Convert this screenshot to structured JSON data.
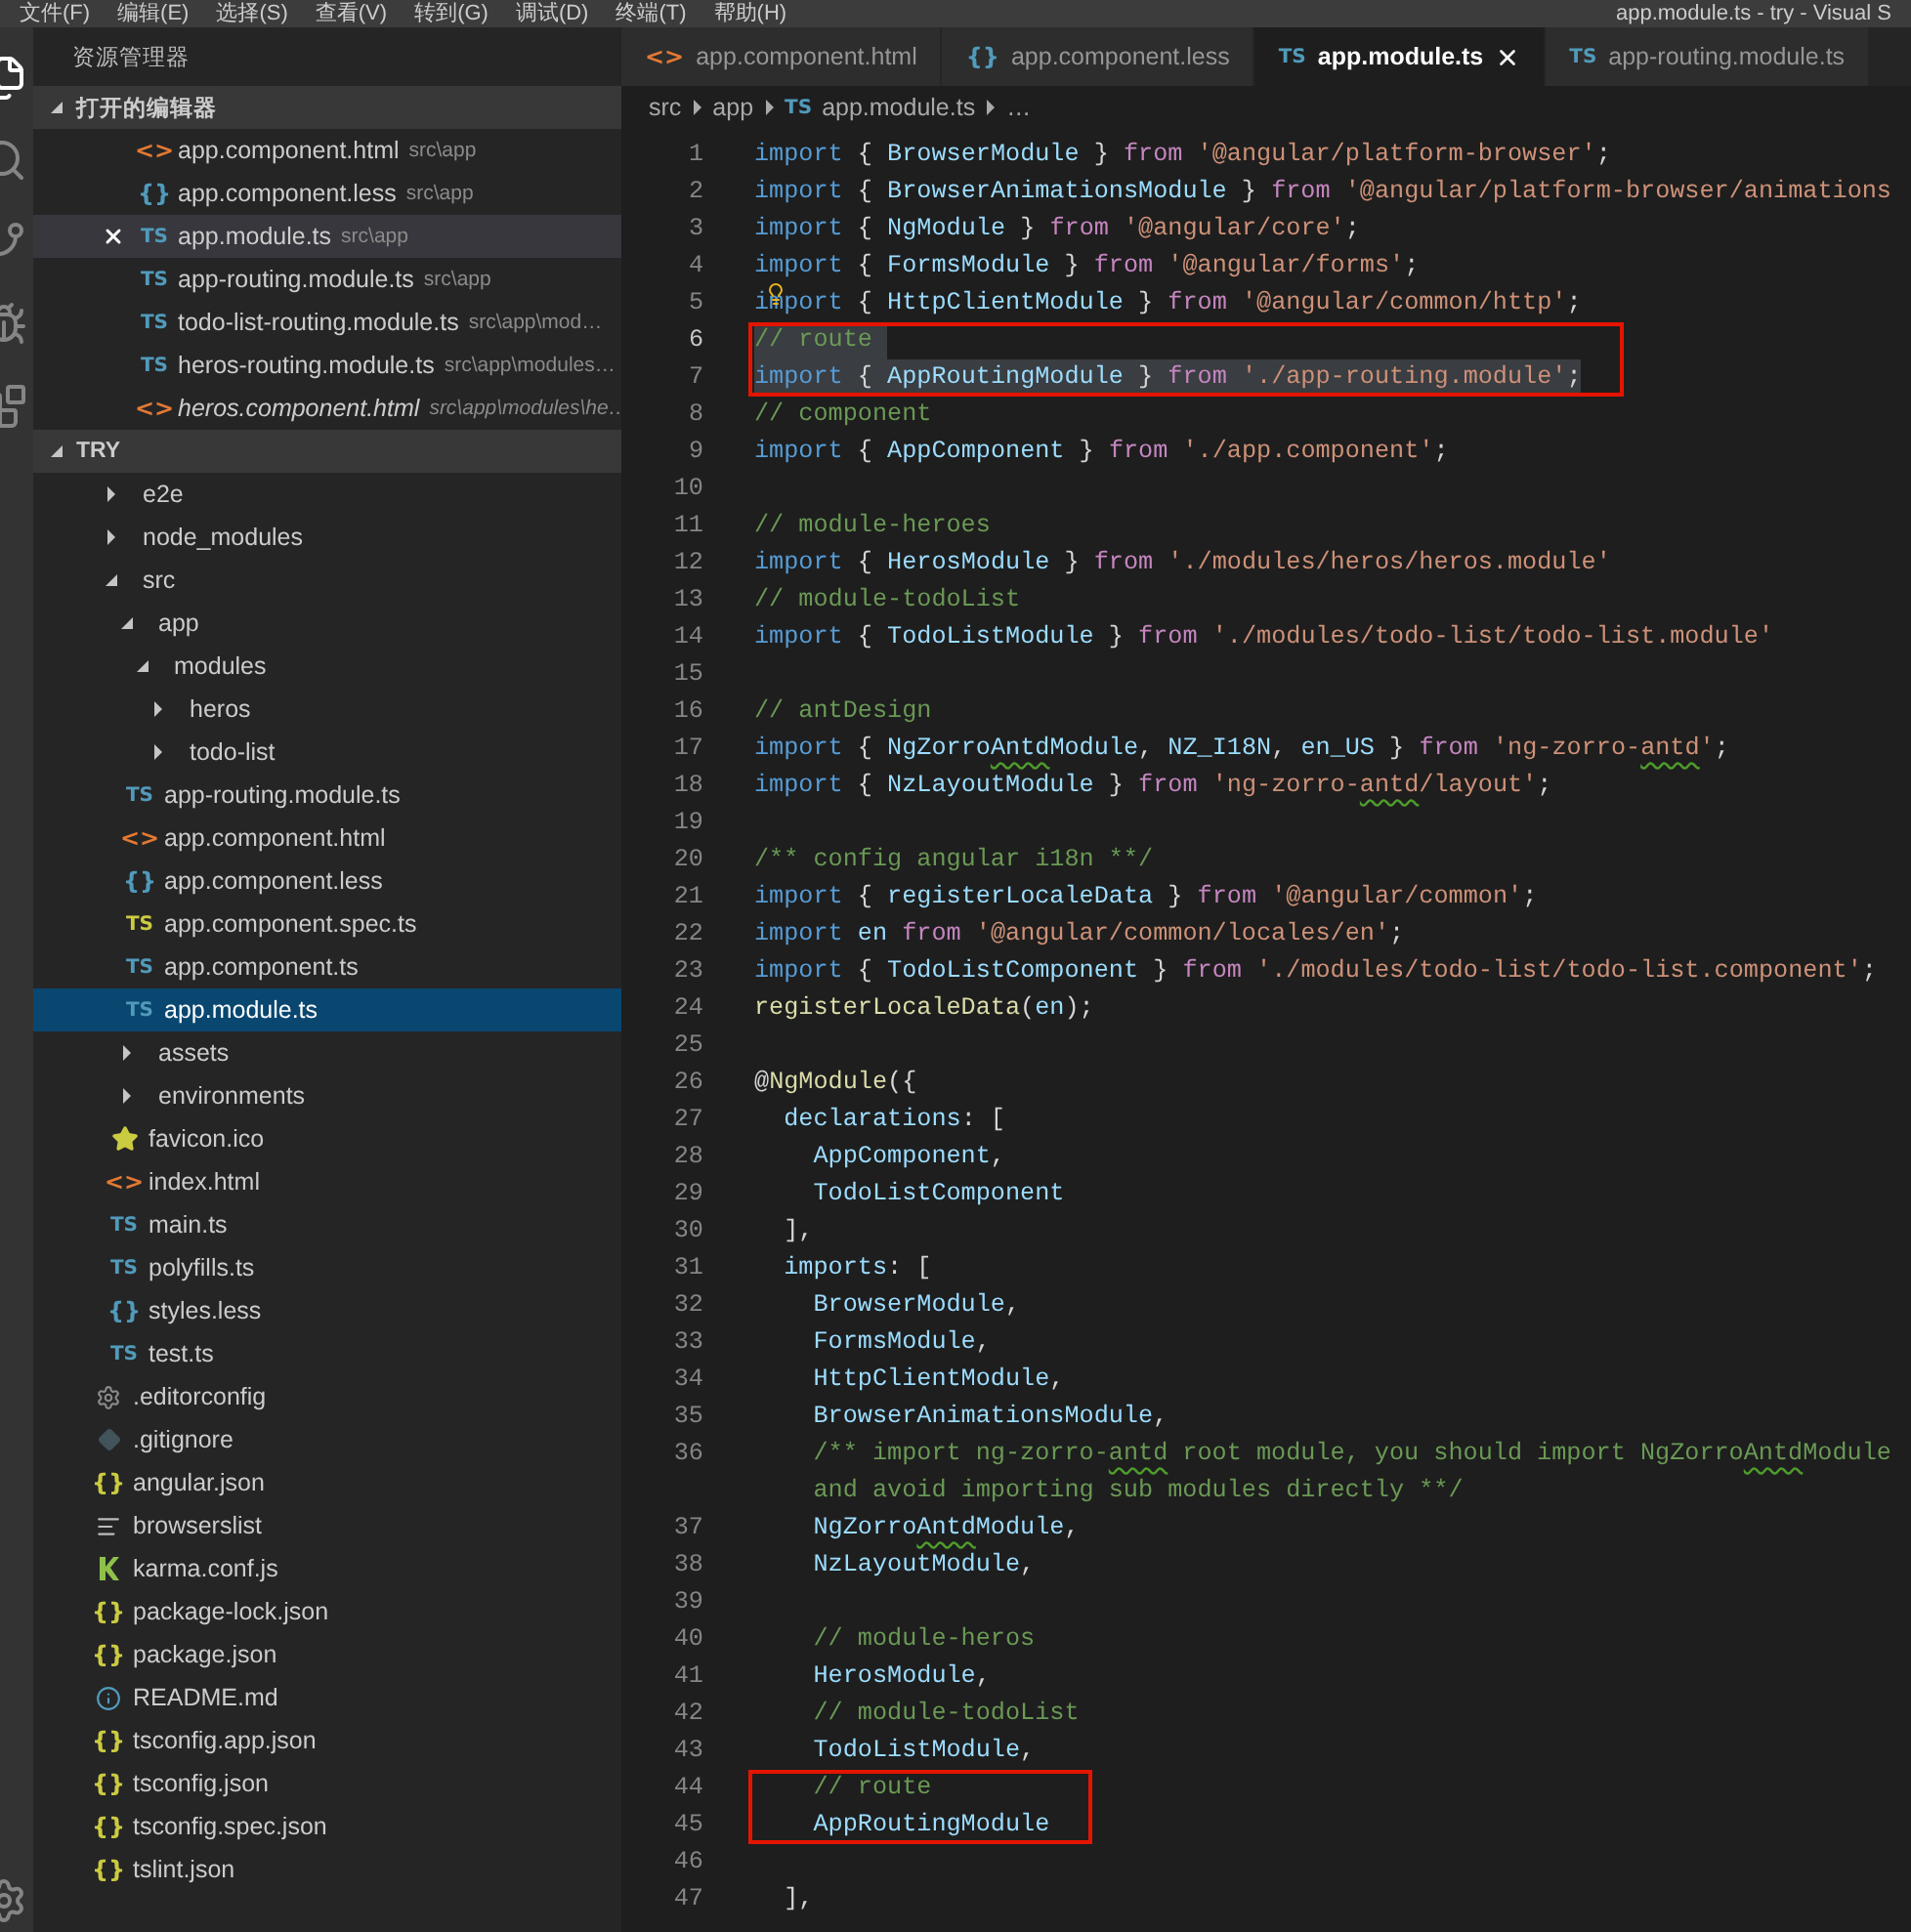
{
  "menu": [
    "文件(F)",
    "编辑(E)",
    "选择(S)",
    "查看(V)",
    "转到(G)",
    "调试(D)",
    "终端(T)",
    "帮助(H)"
  ],
  "window_title": "app.module.ts - try - Visual S",
  "activity_bar": [
    {
      "kind": "files",
      "selected": true
    },
    {
      "kind": "search",
      "selected": false
    },
    {
      "kind": "git",
      "selected": false
    },
    {
      "kind": "debug",
      "selected": false
    },
    {
      "kind": "extensions",
      "selected": false
    },
    {
      "kind": "settings",
      "selected": false
    }
  ],
  "explorer": {
    "title": "资源管理器",
    "open_editors": {
      "title": "打开的编辑器",
      "expanded": true,
      "items": [
        {
          "name": "app.component.html",
          "path": "src\\app",
          "kind": "html",
          "icon": "<>",
          "selected": false,
          "italic": false
        },
        {
          "name": "app.component.less",
          "path": "src\\app",
          "kind": "less",
          "icon": "{}",
          "selected": false,
          "italic": false
        },
        {
          "name": "app.module.ts",
          "path": "src\\app",
          "kind": "ts",
          "icon": "TS",
          "selected": true,
          "italic": false
        },
        {
          "name": "app-routing.module.ts",
          "path": "src\\app",
          "kind": "ts",
          "icon": "TS",
          "selected": false,
          "italic": false
        },
        {
          "name": "todo-list-routing.module.ts",
          "path": "src\\app\\mod…",
          "kind": "ts",
          "icon": "TS",
          "selected": false,
          "italic": false
        },
        {
          "name": "heros-routing.module.ts",
          "path": "src\\app\\modules…",
          "kind": "ts",
          "icon": "TS",
          "selected": false,
          "italic": false
        },
        {
          "name": "heros.component.html",
          "path": "src\\app\\modules\\he…",
          "kind": "html",
          "icon": "<>",
          "selected": false,
          "italic": true
        }
      ]
    },
    "workspace": {
      "title": "TRY",
      "expanded": true,
      "tree": [
        {
          "name": "e2e",
          "kind": "folder",
          "expanded": false,
          "selected": false
        },
        {
          "name": "node_modules",
          "kind": "folder",
          "expanded": false,
          "selected": false
        },
        {
          "name": "src",
          "kind": "folder",
          "expanded": true,
          "selected": false,
          "children": [
            {
              "name": "app",
              "kind": "folder",
              "expanded": true,
              "selected": false,
              "children": [
                {
                  "name": "modules",
                  "kind": "folder",
                  "expanded": true,
                  "selected": false,
                  "children": [
                    {
                      "name": "heros",
                      "kind": "folder",
                      "expanded": false,
                      "selected": false
                    },
                    {
                      "name": "todo-list",
                      "kind": "folder",
                      "expanded": false,
                      "selected": false
                    }
                  ]
                },
                {
                  "name": "app-routing.module.ts",
                  "kind": "ts",
                  "icon": "TS",
                  "selected": false
                },
                {
                  "name": "app.component.html",
                  "kind": "html",
                  "icon": "<>",
                  "selected": false
                },
                {
                  "name": "app.component.less",
                  "kind": "less",
                  "icon": "{}",
                  "selected": false
                },
                {
                  "name": "app.component.spec.ts",
                  "kind": "spec",
                  "icon": "TS",
                  "selected": false
                },
                {
                  "name": "app.component.ts",
                  "kind": "ts",
                  "icon": "TS",
                  "selected": false
                },
                {
                  "name": "app.module.ts",
                  "kind": "ts",
                  "icon": "TS",
                  "selected": true
                }
              ]
            },
            {
              "name": "assets",
              "kind": "folder",
              "expanded": false,
              "selected": false
            },
            {
              "name": "environments",
              "kind": "folder",
              "expanded": false,
              "selected": false
            },
            {
              "name": "favicon.ico",
              "kind": "star",
              "selected": false
            },
            {
              "name": "index.html",
              "kind": "html",
              "icon": "<>",
              "selected": false
            },
            {
              "name": "main.ts",
              "kind": "ts",
              "icon": "TS",
              "selected": false
            },
            {
              "name": "polyfills.ts",
              "kind": "ts",
              "icon": "TS",
              "selected": false
            },
            {
              "name": "styles.less",
              "kind": "less",
              "icon": "{}",
              "selected": false
            },
            {
              "name": "test.ts",
              "kind": "ts",
              "icon": "TS",
              "selected": false
            }
          ]
        },
        {
          "name": ".editorconfig",
          "kind": "gear",
          "selected": false
        },
        {
          "name": ".gitignore",
          "kind": "git",
          "selected": false
        },
        {
          "name": "angular.json",
          "kind": "json",
          "icon": "{}",
          "selected": false
        },
        {
          "name": "browserslist",
          "kind": "list",
          "selected": false
        },
        {
          "name": "karma.conf.js",
          "kind": "karma",
          "selected": false
        },
        {
          "name": "package-lock.json",
          "kind": "json",
          "icon": "{}",
          "selected": false
        },
        {
          "name": "package.json",
          "kind": "json",
          "icon": "{}",
          "selected": false
        },
        {
          "name": "README.md",
          "kind": "info",
          "selected": false
        },
        {
          "name": "tsconfig.app.json",
          "kind": "json",
          "icon": "{}",
          "selected": false
        },
        {
          "name": "tsconfig.json",
          "kind": "json",
          "icon": "{}",
          "selected": false
        },
        {
          "name": "tsconfig.spec.json",
          "kind": "json",
          "icon": "{}",
          "selected": false
        },
        {
          "name": "tslint.json",
          "kind": "json",
          "icon": "{}",
          "selected": false
        }
      ]
    }
  },
  "tabs": [
    {
      "label": "app.component.html",
      "kind": "html",
      "icon": "<>",
      "selected": false
    },
    {
      "label": "app.component.less",
      "kind": "less",
      "icon": "{}",
      "selected": false
    },
    {
      "label": "app.module.ts",
      "kind": "ts",
      "icon": "TS",
      "selected": true
    },
    {
      "label": "app-routing.module.ts",
      "kind": "ts",
      "icon": "TS",
      "selected": false
    }
  ],
  "breadcrumbs": [
    {
      "label": "src",
      "kind": "folder"
    },
    {
      "label": "app",
      "kind": "folder"
    },
    {
      "label": "app.module.ts",
      "kind": "ts",
      "icon": "TS"
    },
    {
      "label": "…",
      "kind": "more"
    }
  ],
  "code": [
    {
      "number": "1",
      "selected": false,
      "boxed": false,
      "tokens": [
        {
          "kind": "kw",
          "text": "import"
        },
        {
          "kind": "p",
          "text": " { "
        },
        {
          "kind": "id",
          "text": "BrowserModule"
        },
        {
          "kind": "p",
          "text": " } "
        },
        {
          "kind": "ctl",
          "text": "from "
        },
        {
          "kind": "str",
          "text": "'@angular/platform-browser'"
        },
        {
          "kind": "p",
          "text": ";"
        }
      ]
    },
    {
      "number": "2",
      "selected": false,
      "boxed": false,
      "tokens": [
        {
          "kind": "kw",
          "text": "import"
        },
        {
          "kind": "p",
          "text": " { "
        },
        {
          "kind": "id",
          "text": "BrowserAnimationsModule"
        },
        {
          "kind": "p",
          "text": " } "
        },
        {
          "kind": "ctl",
          "text": "from "
        },
        {
          "kind": "str",
          "text": "'@angular/platform-browser/animations"
        }
      ]
    },
    {
      "number": "3",
      "selected": false,
      "boxed": false,
      "tokens": [
        {
          "kind": "kw",
          "text": "import"
        },
        {
          "kind": "p",
          "text": " { "
        },
        {
          "kind": "id",
          "text": "NgModule"
        },
        {
          "kind": "p",
          "text": " } "
        },
        {
          "kind": "ctl",
          "text": "from "
        },
        {
          "kind": "str",
          "text": "'@angular/core'"
        },
        {
          "kind": "p",
          "text": ";"
        }
      ]
    },
    {
      "number": "4",
      "selected": false,
      "boxed": false,
      "tokens": [
        {
          "kind": "kw",
          "text": "import"
        },
        {
          "kind": "p",
          "text": " { "
        },
        {
          "kind": "id",
          "text": "FormsModule"
        },
        {
          "kind": "p",
          "text": " } "
        },
        {
          "kind": "ctl",
          "text": "from "
        },
        {
          "kind": "str",
          "text": "'@angular/forms'"
        },
        {
          "kind": "p",
          "text": ";"
        }
      ]
    },
    {
      "number": "5",
      "selected": false,
      "boxed": false,
      "bulb": true,
      "tokens": [
        {
          "kind": "kw",
          "text": "import"
        },
        {
          "kind": "p",
          "text": " { "
        },
        {
          "kind": "id",
          "text": "HttpClientModule"
        },
        {
          "kind": "p",
          "text": " } "
        },
        {
          "kind": "ctl",
          "text": "from "
        },
        {
          "kind": "str",
          "text": "'@angular/common/http'"
        },
        {
          "kind": "p",
          "text": ";"
        }
      ]
    },
    {
      "number": "6",
      "current": true,
      "selected": true,
      "boxed": true,
      "tokens": [
        {
          "kind": "cm",
          "text": "// route "
        }
      ]
    },
    {
      "number": "7",
      "selected": true,
      "boxed": true,
      "tokens": [
        {
          "kind": "kw",
          "text": "import"
        },
        {
          "kind": "p",
          "text": " { "
        },
        {
          "kind": "id",
          "text": "AppRoutingModule"
        },
        {
          "kind": "p",
          "text": " } "
        },
        {
          "kind": "ctl",
          "text": "from "
        },
        {
          "kind": "str",
          "text": "'./app-routing.module'"
        },
        {
          "kind": "p",
          "text": ";"
        }
      ]
    },
    {
      "number": "8",
      "selected": false,
      "boxed": false,
      "tokens": [
        {
          "kind": "cm",
          "text": "// component"
        }
      ]
    },
    {
      "number": "9",
      "selected": false,
      "boxed": false,
      "tokens": [
        {
          "kind": "kw",
          "text": "import"
        },
        {
          "kind": "p",
          "text": " { "
        },
        {
          "kind": "id",
          "text": "AppComponent"
        },
        {
          "kind": "p",
          "text": " } "
        },
        {
          "kind": "ctl",
          "text": "from "
        },
        {
          "kind": "str",
          "text": "'./app.component'"
        },
        {
          "kind": "p",
          "text": ";"
        }
      ]
    },
    {
      "number": "10",
      "selected": false,
      "boxed": false
    },
    {
      "number": "11",
      "selected": false,
      "boxed": false,
      "tokens": [
        {
          "kind": "cm",
          "text": "// module-heroes"
        }
      ]
    },
    {
      "number": "12",
      "selected": false,
      "boxed": false,
      "tokens": [
        {
          "kind": "kw",
          "text": "import"
        },
        {
          "kind": "p",
          "text": " { "
        },
        {
          "kind": "id",
          "text": "HerosModule"
        },
        {
          "kind": "p",
          "text": " } "
        },
        {
          "kind": "ctl",
          "text": "from "
        },
        {
          "kind": "str",
          "text": "'./modules/heros/heros.module'"
        }
      ]
    },
    {
      "number": "13",
      "selected": false,
      "boxed": false,
      "tokens": [
        {
          "kind": "cm",
          "text": "// module-todoList"
        }
      ]
    },
    {
      "number": "14",
      "selected": false,
      "boxed": false,
      "tokens": [
        {
          "kind": "kw",
          "text": "import"
        },
        {
          "kind": "p",
          "text": " { "
        },
        {
          "kind": "id",
          "text": "TodoListModule"
        },
        {
          "kind": "p",
          "text": " } "
        },
        {
          "kind": "ctl",
          "text": "from "
        },
        {
          "kind": "str",
          "text": "'./modules/todo-list/todo-list.module'"
        }
      ]
    },
    {
      "number": "15",
      "selected": false,
      "boxed": false
    },
    {
      "number": "16",
      "selected": false,
      "boxed": false,
      "tokens": [
        {
          "kind": "cm",
          "text": "// antDesign"
        }
      ]
    },
    {
      "number": "17",
      "selected": false,
      "boxed": false,
      "tokens": [
        {
          "kind": "kw",
          "text": "import"
        },
        {
          "kind": "p",
          "text": " { "
        },
        {
          "kind": "id",
          "text": "NgZorro"
        },
        {
          "kind": "id_squiggle",
          "text": "Antd"
        },
        {
          "kind": "id",
          "text": "Module"
        },
        {
          "kind": "p",
          "text": ", "
        },
        {
          "kind": "id",
          "text": "NZ_I18N"
        },
        {
          "kind": "p",
          "text": ", "
        },
        {
          "kind": "id",
          "text": "en_US"
        },
        {
          "kind": "p",
          "text": " } "
        },
        {
          "kind": "ctl",
          "text": "from "
        },
        {
          "kind": "str",
          "text": "'ng-zorro-"
        },
        {
          "kind": "str_squiggle",
          "text": "antd"
        },
        {
          "kind": "str",
          "text": "'"
        },
        {
          "kind": "p",
          "text": ";"
        }
      ]
    },
    {
      "number": "18",
      "selected": false,
      "boxed": false,
      "tokens": [
        {
          "kind": "kw",
          "text": "import"
        },
        {
          "kind": "p",
          "text": " { "
        },
        {
          "kind": "id",
          "text": "NzLayoutModule"
        },
        {
          "kind": "p",
          "text": " } "
        },
        {
          "kind": "ctl",
          "text": "from "
        },
        {
          "kind": "str",
          "text": "'ng-zorro-"
        },
        {
          "kind": "str_squiggle",
          "text": "antd"
        },
        {
          "kind": "str",
          "text": "/layout'"
        },
        {
          "kind": "p",
          "text": ";"
        }
      ]
    },
    {
      "number": "19",
      "selected": false,
      "boxed": false
    },
    {
      "number": "20",
      "selected": false,
      "boxed": false,
      "tokens": [
        {
          "kind": "cm",
          "text": "/** config angular i18n **/"
        }
      ]
    },
    {
      "number": "21",
      "selected": false,
      "boxed": false,
      "tokens": [
        {
          "kind": "kw",
          "text": "import"
        },
        {
          "kind": "p",
          "text": " { "
        },
        {
          "kind": "id",
          "text": "registerLocaleData"
        },
        {
          "kind": "p",
          "text": " } "
        },
        {
          "kind": "ctl",
          "text": "from "
        },
        {
          "kind": "str",
          "text": "'@angular/common'"
        },
        {
          "kind": "p",
          "text": ";"
        }
      ]
    },
    {
      "number": "22",
      "selected": false,
      "boxed": false,
      "tokens": [
        {
          "kind": "kw",
          "text": "import "
        },
        {
          "kind": "id",
          "text": "en "
        },
        {
          "kind": "ctl",
          "text": "from "
        },
        {
          "kind": "str",
          "text": "'@angular/common/locales/en'"
        },
        {
          "kind": "p",
          "text": ";"
        }
      ]
    },
    {
      "number": "23",
      "selected": false,
      "boxed": false,
      "tokens": [
        {
          "kind": "kw",
          "text": "import"
        },
        {
          "kind": "p",
          "text": " { "
        },
        {
          "kind": "id",
          "text": "TodoListComponent"
        },
        {
          "kind": "p",
          "text": " } "
        },
        {
          "kind": "ctl",
          "text": "from "
        },
        {
          "kind": "str",
          "text": "'./modules/todo-list/todo-list.component'"
        },
        {
          "kind": "p",
          "text": ";"
        }
      ]
    },
    {
      "number": "24",
      "selected": false,
      "boxed": false,
      "tokens": [
        {
          "kind": "fn",
          "text": "registerLocaleData"
        },
        {
          "kind": "p",
          "text": "("
        },
        {
          "kind": "id",
          "text": "en"
        },
        {
          "kind": "p",
          "text": ");"
        }
      ]
    },
    {
      "number": "25",
      "selected": false,
      "boxed": false
    },
    {
      "number": "26",
      "selected": false,
      "boxed": false,
      "tokens": [
        {
          "kind": "p",
          "text": "@"
        },
        {
          "kind": "fn",
          "text": "NgModule"
        },
        {
          "kind": "p",
          "text": "({"
        }
      ]
    },
    {
      "number": "27",
      "selected": false,
      "boxed": false,
      "tokens": [
        {
          "kind": "id",
          "text": "  declarations"
        },
        {
          "kind": "p",
          "text": ": ["
        }
      ]
    },
    {
      "number": "28",
      "selected": false,
      "boxed": false,
      "tokens": [
        {
          "kind": "id",
          "text": "    AppComponent"
        },
        {
          "kind": "p",
          "text": ","
        }
      ]
    },
    {
      "number": "29",
      "selected": false,
      "boxed": false,
      "tokens": [
        {
          "kind": "id",
          "text": "    TodoListComponent"
        }
      ]
    },
    {
      "number": "30",
      "selected": false,
      "boxed": false,
      "tokens": [
        {
          "kind": "p",
          "text": "  ],"
        }
      ]
    },
    {
      "number": "31",
      "selected": false,
      "boxed": false,
      "tokens": [
        {
          "kind": "id",
          "text": "  imports"
        },
        {
          "kind": "p",
          "text": ": ["
        }
      ]
    },
    {
      "number": "32",
      "selected": false,
      "boxed": false,
      "tokens": [
        {
          "kind": "id",
          "text": "    BrowserModule"
        },
        {
          "kind": "p",
          "text": ","
        }
      ]
    },
    {
      "number": "33",
      "selected": false,
      "boxed": false,
      "tokens": [
        {
          "kind": "id",
          "text": "    FormsModule"
        },
        {
          "kind": "p",
          "text": ","
        }
      ]
    },
    {
      "number": "34",
      "selected": false,
      "boxed": false,
      "tokens": [
        {
          "kind": "id",
          "text": "    HttpClientModule"
        },
        {
          "kind": "p",
          "text": ","
        }
      ]
    },
    {
      "number": "35",
      "selected": false,
      "boxed": false,
      "tokens": [
        {
          "kind": "id",
          "text": "    BrowserAnimationsModule"
        },
        {
          "kind": "p",
          "text": ","
        }
      ]
    },
    {
      "number": "36",
      "selected": false,
      "boxed": false,
      "tokens": [
        {
          "kind": "cm",
          "text": "    /** import ng-zorro-"
        },
        {
          "kind": "cm_squiggle",
          "text": "antd"
        },
        {
          "kind": "cm",
          "text": " root module, you should import NgZorro"
        },
        {
          "kind": "cm_squiggle",
          "text": "Antd"
        },
        {
          "kind": "cm",
          "text": "Module"
        }
      ]
    },
    {
      "selected": false,
      "boxed": false,
      "tokens": [
        {
          "kind": "cm",
          "text": "    and avoid importing sub modules directly **/"
        }
      ]
    },
    {
      "number": "37",
      "selected": false,
      "boxed": false,
      "tokens": [
        {
          "kind": "id",
          "text": "    NgZorro"
        },
        {
          "kind": "id_squiggle",
          "text": "Antd"
        },
        {
          "kind": "id",
          "text": "Module"
        },
        {
          "kind": "p",
          "text": ","
        }
      ]
    },
    {
      "number": "38",
      "selected": false,
      "boxed": false,
      "tokens": [
        {
          "kind": "id",
          "text": "    NzLayoutModule"
        },
        {
          "kind": "p",
          "text": ","
        }
      ]
    },
    {
      "number": "39",
      "selected": false,
      "boxed": false
    },
    {
      "number": "40",
      "selected": false,
      "boxed": false,
      "tokens": [
        {
          "kind": "cm",
          "text": "    // module-heros"
        }
      ]
    },
    {
      "number": "41",
      "selected": false,
      "boxed": false,
      "tokens": [
        {
          "kind": "id",
          "text": "    HerosModule"
        },
        {
          "kind": "p",
          "text": ","
        }
      ]
    },
    {
      "number": "42",
      "selected": false,
      "boxed": false,
      "tokens": [
        {
          "kind": "cm",
          "text": "    // module-todoList"
        }
      ]
    },
    {
      "number": "43",
      "selected": false,
      "boxed": false,
      "tokens": [
        {
          "kind": "id",
          "text": "    TodoListModule"
        },
        {
          "kind": "p",
          "text": ","
        }
      ]
    },
    {
      "number": "44",
      "selected": false,
      "boxed": true,
      "tokens": [
        {
          "kind": "cm",
          "text": "    // route"
        }
      ]
    },
    {
      "number": "45",
      "selected": false,
      "boxed": true,
      "tokens": [
        {
          "kind": "id",
          "text": "    AppRoutingModule"
        }
      ]
    },
    {
      "number": "46",
      "selected": false,
      "boxed": false
    },
    {
      "number": "47",
      "selected": false,
      "boxed": false,
      "tokens": [
        {
          "kind": "p",
          "text": "  ],"
        }
      ]
    }
  ]
}
